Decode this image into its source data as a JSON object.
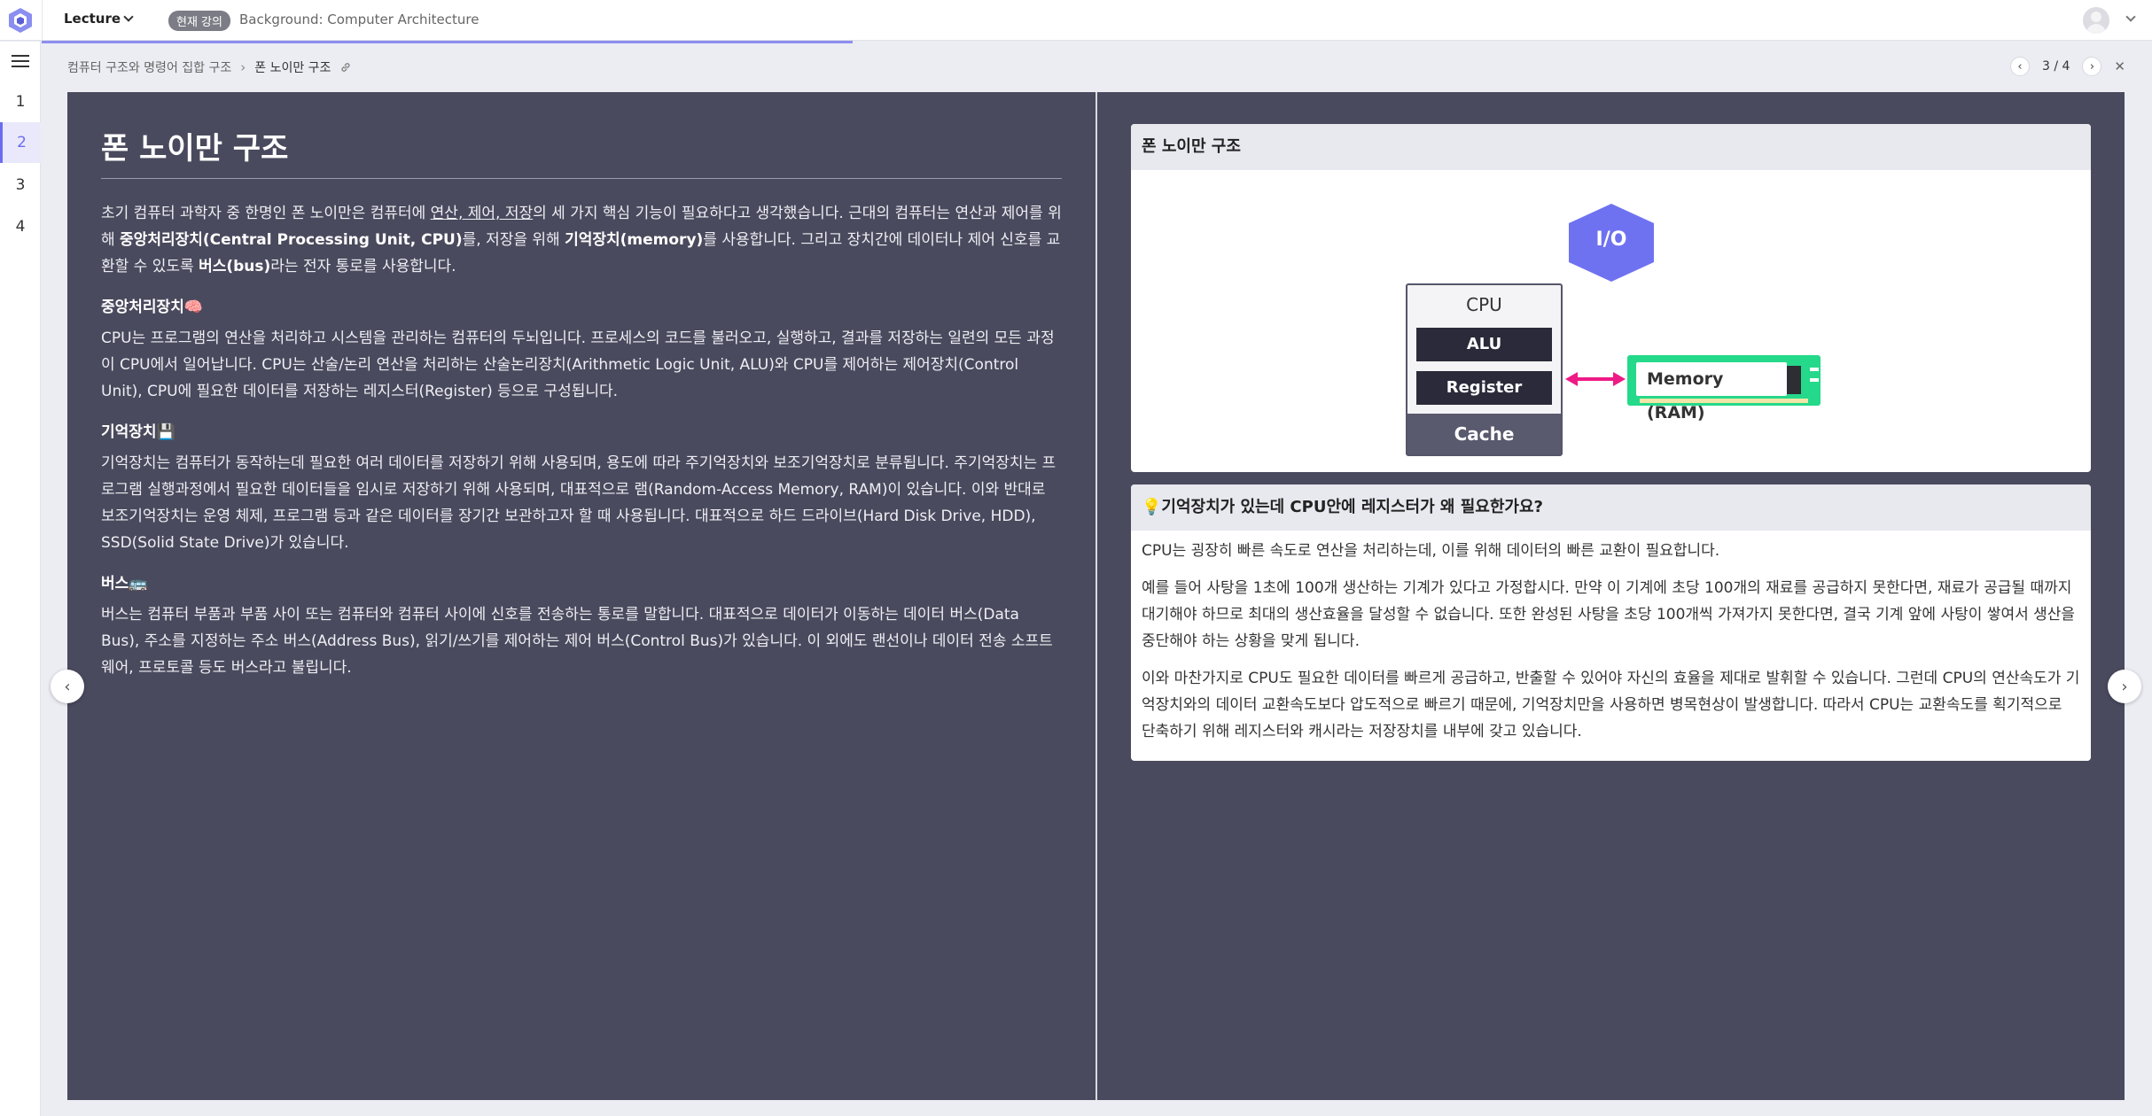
{
  "topbar": {
    "menu_label": "Lecture",
    "badge": "현재 강의",
    "course_title": "Background: Computer Architecture"
  },
  "sidebar": {
    "items": [
      {
        "label": "1",
        "active": false
      },
      {
        "label": "2",
        "active": true
      },
      {
        "label": "3",
        "active": false
      },
      {
        "label": "4",
        "active": false
      }
    ]
  },
  "breadcrumb": {
    "parent": "컴퓨터 구조와 명령어 집합 구조",
    "current": "폰 노이만 구조"
  },
  "pager": {
    "text": "3 / 4"
  },
  "lesson": {
    "title": "폰 노이만 구조",
    "intro": {
      "p1": "초기 컴퓨터 과학자 중 한명인 폰 노이만은 컴퓨터에 ",
      "u1": "연산, 제어, 저장",
      "p2": "의 세 가지 핵심 기능이 필요하다고 생각했습니다. 근대의 컴퓨터는 연산과 제어를 위해 ",
      "b1": "중앙처리장치(Central Processing Unit, CPU)",
      "p3": "를, 저장을 위해 ",
      "b2": "기억장치(memory)",
      "p4": "를 사용합니다. 그리고 장치간에 데이터나 제어 신호를 교환할 수 있도록 ",
      "b3": "버스(bus)",
      "p5": "라는 전자 통로를 사용합니다."
    },
    "cpu_heading": "중앙처리장치🧠",
    "cpu_text": "CPU는 프로그램의 연산을 처리하고 시스템을 관리하는 컴퓨터의 두뇌입니다. 프로세스의 코드를 불러오고, 실행하고, 결과를 저장하는 일련의 모든 과정이 CPU에서 일어납니다. CPU는 산술/논리 연산을 처리하는 산술논리장치(Arithmetic Logic Unit, ALU)와 CPU를 제어하는 제어장치(Control Unit), CPU에 필요한 데이터를 저장하는 레지스터(Register) 등으로 구성됩니다.",
    "mem_heading": "기억장치💾",
    "mem_text": "기억장치는 컴퓨터가 동작하는데 필요한 여러 데이터를 저장하기 위해 사용되며, 용도에 따라 주기억장치와 보조기억장치로 분류됩니다. 주기억장치는 프로그램 실행과정에서 필요한 데이터들을 임시로 저장하기 위해 사용되며, 대표적으로 램(Random-Access Memory, RAM)이 있습니다. 이와 반대로 보조기억장치는 운영 체제, 프로그램 등과 같은 데이터를 장기간 보관하고자 할 때 사용됩니다. 대표적으로 하드 드라이브(Hard Disk Drive, HDD), SSD(Solid State Drive)가 있습니다.",
    "bus_heading": "버스🚌",
    "bus_text": "버스는 컴퓨터 부품과 부품 사이 또는 컴퓨터와 컴퓨터 사이에 신호를 전송하는 통로를 말합니다. 대표적으로 데이터가 이동하는 데이터 버스(Data Bus), 주소를 지정하는 주소 버스(Address Bus), 읽기/쓰기를 제어하는 제어 버스(Control Bus)가 있습니다. 이 외에도 랜선이나 데이터 전송 소프트웨어, 프로토콜 등도 버스라고 불립니다."
  },
  "diagram_card": {
    "title": "폰 노이만 구조",
    "io": "I/O",
    "cpu": "CPU",
    "alu": "ALU",
    "register": "Register",
    "cache": "Cache",
    "memory": "Memory (RAM)",
    "colors": {
      "io": "#6f72f0",
      "memory": "#25d98a",
      "arrow": "#ee1a86"
    }
  },
  "faq_card": {
    "title": "💡기억장치가 있는데 CPU안에 레지스터가 왜 필요한가요?",
    "p1": "CPU는 굉장히 빠른 속도로 연산을 처리하는데, 이를 위해 데이터의 빠른 교환이 필요합니다.",
    "p2": "예를 들어 사탕을 1초에 100개 생산하는 기계가 있다고 가정합시다. 만약 이 기계에 초당 100개의 재료를 공급하지 못한다면, 재료가 공급될 때까지 대기해야 하므로 최대의 생산효율을 달성할 수 없습니다. 또한 완성된 사탕을 초당 100개씩 가져가지 못한다면, 결국 기계 앞에 사탕이 쌓여서 생산을 중단해야 하는 상황을 맞게 됩니다.",
    "p3": "이와 마찬가지로 CPU도 필요한 데이터를 빠르게 공급하고, 반출할 수 있어야 자신의 효율을 제대로 발휘할 수 있습니다. 그런데 CPU의 연산속도가 기억장치와의 데이터 교환속도보다 압도적으로 빠르기 때문에, 기억장치만을 사용하면 병목현상이 발생합니다. 따라서 CPU는 교환속도를 획기적으로 단축하기 위해 레지스터와 캐시라는 저장장치를 내부에 갖고 있습니다."
  }
}
